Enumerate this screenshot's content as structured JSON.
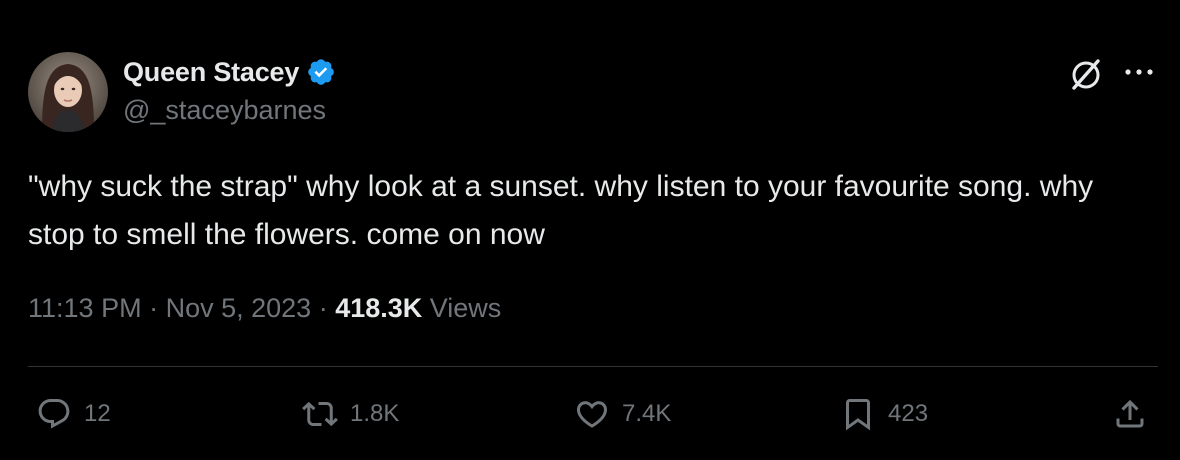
{
  "author": {
    "display_name": "Queen Stacey",
    "handle": "@_staceybarnes",
    "verified": true
  },
  "tweet": {
    "text": "\"why suck the strap\" why look at a sunset. why listen to your favourite song. why stop to smell the flowers. come on now"
  },
  "meta": {
    "time": "11:13 PM",
    "sep1": " · ",
    "date": "Nov 5, 2023",
    "sep2": " · ",
    "views_count": "418.3K",
    "views_label": " Views"
  },
  "actions": {
    "replies": "12",
    "reposts": "1.8K",
    "likes": "7.4K",
    "bookmarks": "423"
  },
  "icons": {
    "verified": "verified-badge-icon",
    "grok": "grok-icon",
    "more": "more-icon",
    "reply": "reply-icon",
    "repost": "repost-icon",
    "like": "heart-icon",
    "bookmark": "bookmark-icon",
    "share": "share-icon"
  },
  "colors": {
    "background": "#000000",
    "text_primary": "#e7e9ea",
    "text_secondary": "#71767b",
    "verified_blue": "#1d9bf0",
    "divider": "#2f3336"
  }
}
